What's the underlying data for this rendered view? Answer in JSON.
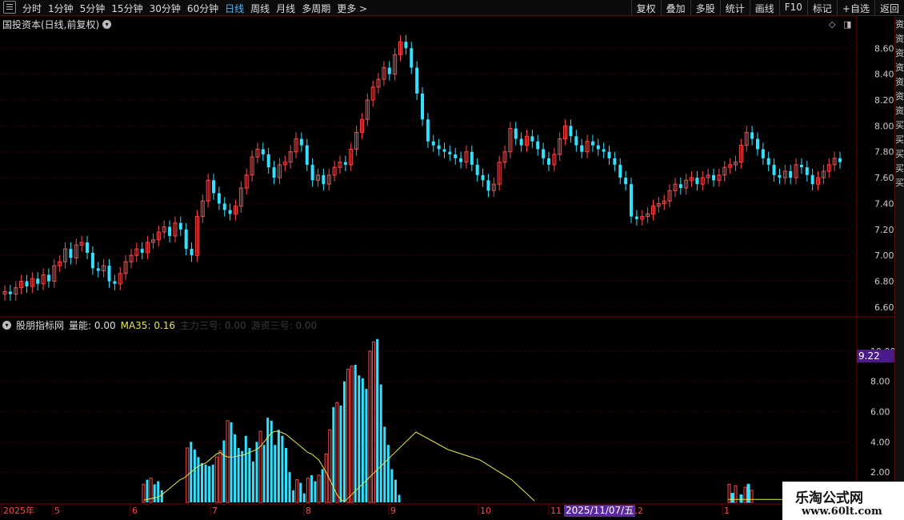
{
  "toolbar": {
    "periods": [
      "分时",
      "1分钟",
      "5分钟",
      "15分钟",
      "30分钟",
      "60分钟",
      "日线",
      "周线",
      "月线",
      "多周期",
      "更多 >"
    ],
    "active_period": "日线",
    "tools": [
      "复权",
      "叠加",
      "多股",
      "统计",
      "画线",
      "F10",
      "标记",
      "+自选",
      "返回"
    ]
  },
  "price_panel": {
    "title": "国投资本(日线,前复权)",
    "y_ticks": [
      "8.60",
      "8.40",
      "8.20",
      "8.00",
      "7.80",
      "7.60",
      "7.40",
      "7.20",
      "7.00",
      "6.80",
      "6.60"
    ]
  },
  "indicator_panel": {
    "name": "股朋指标网",
    "vol_label": "量能:",
    "vol_value": "0.00",
    "ma_label": "MA35:",
    "ma_value": "0.16",
    "extra1": "主力三号: 0.00",
    "extra2": "游资三号: 0.00",
    "y_ticks": [
      "10.00",
      "8.00",
      "6.00",
      "4.00",
      "2.00"
    ],
    "current_tag": "9.22"
  },
  "x_axis": {
    "labels": [
      "2025年",
      "5",
      "6",
      "7",
      "8",
      "9",
      "10",
      "11",
      "12",
      "1"
    ],
    "date_tag": "2025/11/07/五"
  },
  "right_strip_text": "资资资资资资资买买买买买",
  "watermark": {
    "line1": "乐淘公式网",
    "line2": "www.60lt.com"
  },
  "colors": {
    "up": "#ff4a4a",
    "down": "#33e0ff",
    "ma": "#e6e64a",
    "grid": "#3a0000",
    "tag": "#4a1a8a"
  },
  "icons": {
    "menu": "menu-icon",
    "collapse": "chevron-down-icon",
    "diamond": "diamond-icon",
    "square": "square-icon"
  },
  "chart_data": [
    {
      "type": "candlestick",
      "title": "国投资本(日线,前复权)",
      "ylim": [
        6.55,
        8.75
      ],
      "series": [
        {
          "values": [
            6.72,
            6.7,
            6.75,
            6.8,
            6.76,
            6.82,
            6.78,
            6.85,
            6.8,
            6.92,
            6.95,
            7.05,
            6.98,
            7.08,
            7.1,
            7.02,
            6.9,
            6.88,
            6.92,
            6.8,
            6.78,
            6.86,
            6.95,
            7.0,
            7.05,
            7.02,
            7.1,
            7.12,
            7.18,
            7.22,
            7.15,
            7.25,
            7.2,
            7.05,
            7.0,
            7.3,
            7.42,
            7.58,
            7.48,
            7.4,
            7.35,
            7.32,
            7.38,
            7.52,
            7.62,
            7.76,
            7.82,
            7.78,
            7.68,
            7.6,
            7.7,
            7.72,
            7.8,
            7.9,
            7.85,
            7.7,
            7.58,
            7.62,
            7.55,
            7.62,
            7.68,
            7.72,
            7.7,
            7.82,
            7.95,
            8.05,
            8.2,
            8.3,
            8.36,
            8.45,
            8.4,
            8.55,
            8.65,
            8.6,
            8.45,
            8.25,
            8.05,
            7.88,
            7.85,
            7.82,
            7.8,
            7.78,
            7.75,
            7.72,
            7.8,
            7.7,
            7.62,
            7.58,
            7.5,
            7.55,
            7.72,
            7.8,
            7.98,
            7.9,
            7.85,
            7.92,
            7.88,
            7.82,
            7.75,
            7.7,
            7.78,
            7.9,
            8.0,
            7.92,
            7.85,
            7.8,
            7.88,
            7.85,
            7.82,
            7.8,
            7.75,
            7.7,
            7.6,
            7.55,
            7.3,
            7.28,
            7.3,
            7.32,
            7.38,
            7.4,
            7.42,
            7.5,
            7.55,
            7.52,
            7.58,
            7.6,
            7.55,
            7.6,
            7.62,
            7.58,
            7.62,
            7.68,
            7.7,
            7.72,
            7.85,
            7.95,
            7.9,
            7.82,
            7.75,
            7.7,
            7.62,
            7.6,
            7.65,
            7.6,
            7.7,
            7.68,
            7.62,
            7.55,
            7.6,
            7.65,
            7.7,
            7.75,
            7.72
          ]
        }
      ]
    },
    {
      "type": "bar",
      "title": "股朋指标网",
      "ylim": [
        0,
        11
      ],
      "series": [
        {
          "name": "量能",
          "values": [
            0,
            0,
            0,
            0,
            0,
            0,
            0,
            0,
            0,
            0,
            0,
            0,
            0,
            0,
            0,
            0,
            0,
            0,
            0,
            0,
            0,
            0,
            0,
            0,
            0,
            0,
            0,
            0,
            0,
            0,
            0,
            0,
            0,
            0,
            0,
            0,
            0,
            0,
            1.2,
            1.5,
            1.6,
            1.2,
            1.4,
            0.8,
            0,
            0,
            0,
            0,
            0,
            0,
            3.6,
            4.0,
            3.5,
            3.0,
            2.6,
            2.5,
            2.4,
            2.5,
            3.0,
            3.4,
            4.1,
            5.4,
            5.3,
            4.5,
            3.6,
            3.4,
            4.4,
            3.6,
            2.7,
            4.0,
            4.7,
            3.8,
            5.6,
            5.4,
            3.8,
            4.8,
            4.4,
            3.6,
            2.0,
            0.8,
            1.5,
            1.3,
            0.6,
            1.6,
            1.8,
            1.4,
            1.8,
            2.2,
            3.2,
            4.8,
            6.3,
            6.6,
            6.4,
            8.0,
            8.8,
            9.0,
            9.1,
            8.4,
            8.2,
            7.5,
            10.0,
            10.6,
            10.8,
            7.8,
            5.0,
            3.8,
            2.2,
            1.5,
            0.5
          ],
          "ma35": [
            0,
            0,
            0,
            0,
            0,
            0,
            0,
            0,
            0,
            0,
            0,
            0,
            0,
            0,
            0,
            0,
            0,
            0,
            0,
            0,
            0,
            0,
            0,
            0,
            0,
            0,
            0,
            0,
            0,
            0,
            0,
            0,
            0,
            0,
            0,
            0,
            0,
            0,
            0.15,
            0.2,
            0.25,
            0.3,
            0.35,
            0.5,
            0.7,
            0.9,
            1.1,
            1.3,
            1.5,
            1.6,
            1.8,
            2.0,
            2.2,
            2.4,
            2.5,
            2.6,
            2.8,
            3.0,
            3.2,
            3.3,
            3.1,
            3.0,
            3.0,
            3.0,
            3.1,
            3.1,
            3.2,
            3.3,
            3.4,
            3.5,
            3.7,
            4.0,
            4.3,
            4.6,
            4.7,
            4.7,
            4.6,
            4.5,
            4.3,
            4.1,
            3.9,
            3.7,
            3.5,
            3.3,
            3.2,
            3.0,
            2.8,
            2.4,
            2.0,
            1.5,
            1.0,
            0.5,
            0.2,
            0.05,
            0
          ]
        }
      ]
    }
  ]
}
